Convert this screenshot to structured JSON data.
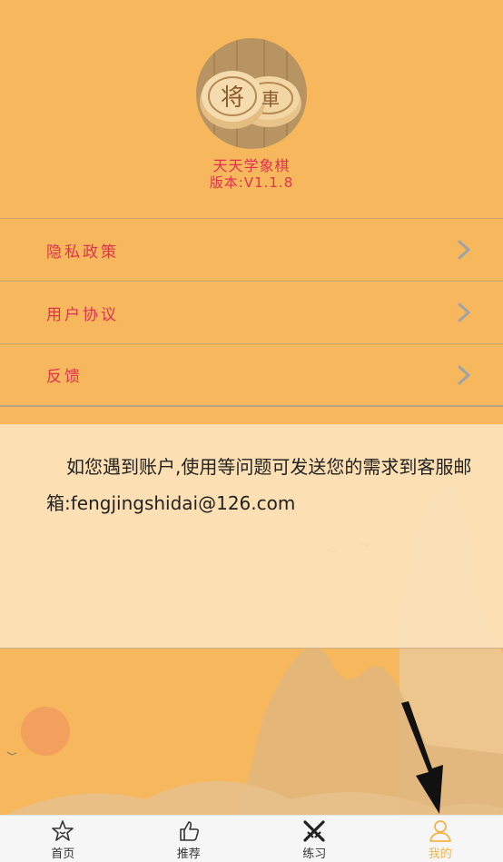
{
  "app": {
    "name": "天天学象棋",
    "version": "版本:V1.1.8",
    "logo_text_1": "将",
    "logo_text_2": "車"
  },
  "menu": [
    {
      "label": "隐私政策",
      "icon": "chevron-right-icon"
    },
    {
      "label": "用户协议",
      "icon": "chevron-right-icon"
    },
    {
      "label": "反馈",
      "icon": "chevron-right-icon"
    }
  ],
  "info": {
    "text": "如您遇到账户,使用等问题可发送您的需求到客服邮箱:fengjingshidai@126.com"
  },
  "tabbar": {
    "tabs": [
      {
        "label": "首页",
        "icon": "star-home-icon"
      },
      {
        "label": "推荐",
        "icon": "thumbs-up-icon"
      },
      {
        "label": "练习",
        "icon": "crossed-swords-icon"
      },
      {
        "label": "我的",
        "icon": "user-icon",
        "active": true
      }
    ]
  },
  "colors": {
    "background": "#f7b85d",
    "accent_red": "#e0324e",
    "active_tab": "#f5b347"
  }
}
